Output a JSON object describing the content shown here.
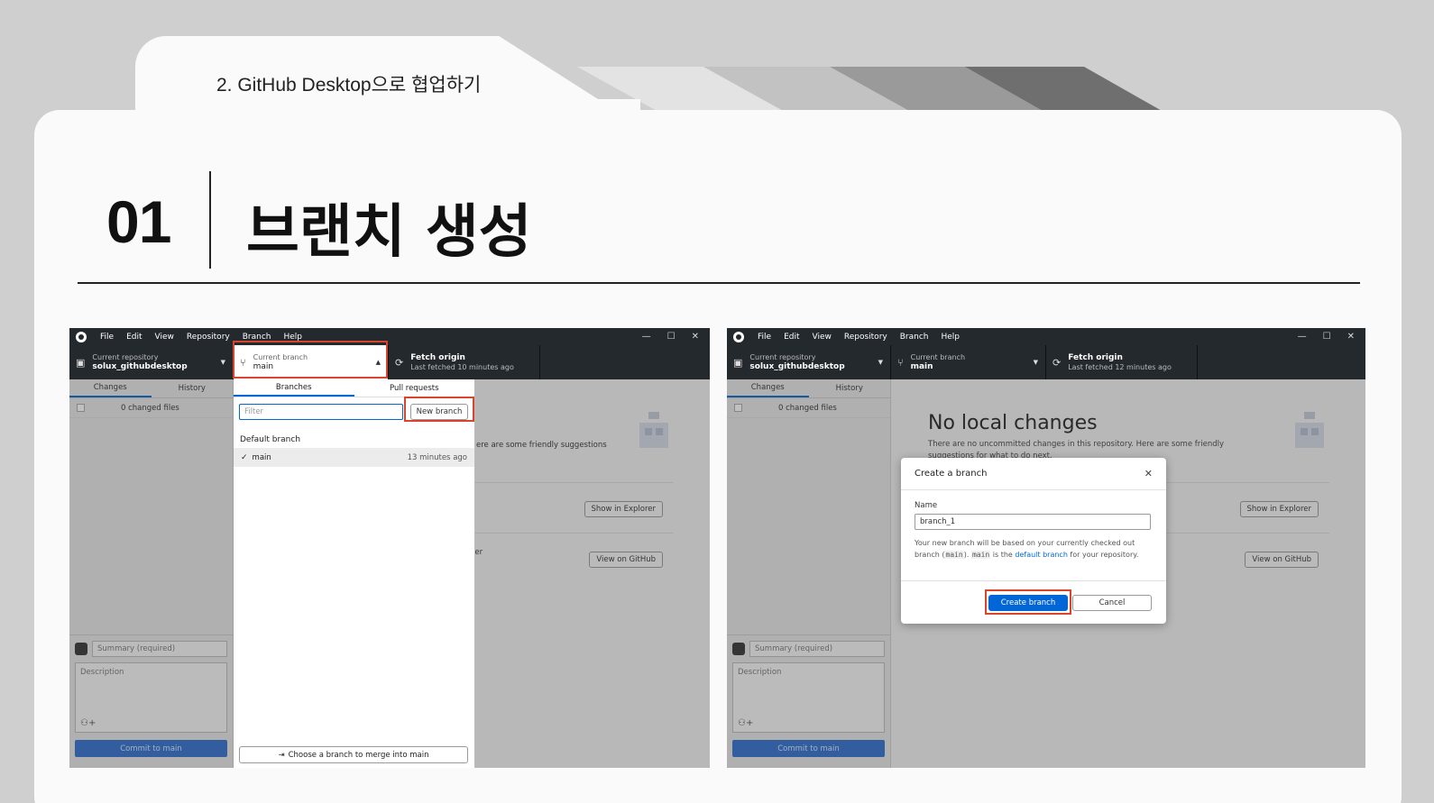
{
  "slide": {
    "tab_caption": "2. GitHub Desktop으로 협업하기",
    "section_number": "01",
    "section_title": "브랜치 생성"
  },
  "menu": {
    "items": [
      "File",
      "Edit",
      "View",
      "Repository",
      "Branch",
      "Help"
    ],
    "window_controls": [
      "—",
      "☐",
      "✕"
    ]
  },
  "toolbar": {
    "repo_caption": "Current repository",
    "repo_name": "solux_githubdesktop",
    "branch_caption": "Current branch",
    "branch_name": "main",
    "fetch_title": "Fetch origin",
    "fetch_left_subtitle": "Last fetched 10 minutes ago",
    "fetch_right_subtitle": "Last fetched 12 minutes ago"
  },
  "sidebar": {
    "tabs": [
      "Changes",
      "History"
    ],
    "changed_files": "0 changed files",
    "summary_placeholder": "Summary (required)",
    "description_placeholder": "Description",
    "commit_label": "Commit to main",
    "coauthor_icon": "add-coauthor-icon"
  },
  "main": {
    "no_changes_title": "No local changes",
    "no_changes_sub": "There are no uncommitted changes in this repository. Here are some friendly suggestions for what to do next.",
    "partial_sub": "ere are some friendly suggestions",
    "partial_browser": "ser",
    "show_in_explorer": "Show in Explorer",
    "view_on_github": "View on GitHub"
  },
  "branch_dropdown": {
    "tabs": [
      "Branches",
      "Pull requests"
    ],
    "filter_placeholder": "Filter",
    "new_branch_label": "New branch",
    "group_label": "Default branch",
    "branches": [
      {
        "name": "main",
        "ago": "13 minutes ago"
      }
    ],
    "merge_label": "Choose a branch to merge into main"
  },
  "create_branch_modal": {
    "title": "Create a branch",
    "name_label": "Name",
    "name_value": "branch_1",
    "note_prefix": "Your new branch will be based on your currently checked out branch (",
    "note_code1": "main",
    "note_mid": "). ",
    "note_code2": "main",
    "note_is": " is the ",
    "note_link": "default branch",
    "note_suffix": " for your repository.",
    "create_label": "Create branch",
    "cancel_label": "Cancel"
  },
  "colors": {
    "highlight": "#d9452b",
    "primary_button": "#0366d6",
    "titlebar": "#24292e"
  }
}
